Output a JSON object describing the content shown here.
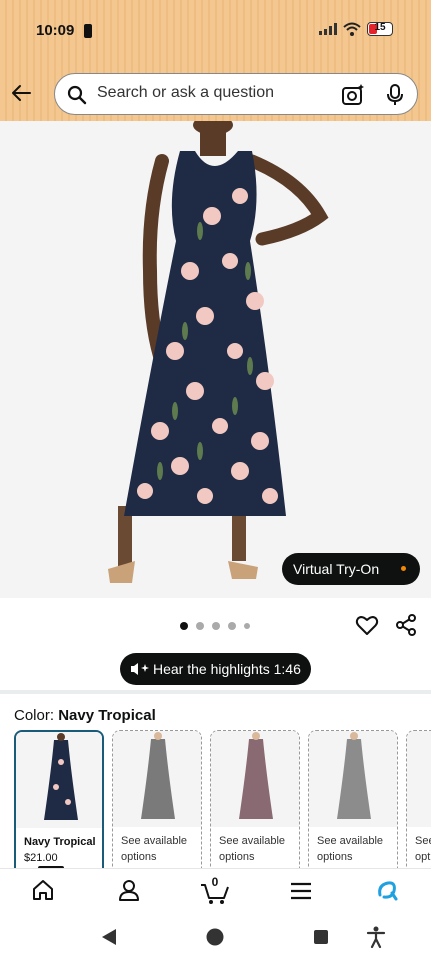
{
  "status_bar": {
    "time": "10:09",
    "battery_level": "15"
  },
  "search": {
    "placeholder": "Search or ask a question"
  },
  "product": {
    "virtual_try_on_label": "Virtual Try-On",
    "image_count": 5,
    "active_image_index": 1
  },
  "highlights": {
    "label": "Hear the highlights 1:46"
  },
  "color": {
    "label": "Color: ",
    "selected_name": "Navy Tropical",
    "swatches": [
      {
        "line1": "Navy Tropical",
        "line2": "$21.00",
        "dress_color": "#1f2a44",
        "selected": true
      },
      {
        "line1": "See available",
        "line2": "options",
        "dress_color": "#7a7a7a",
        "selected": false
      },
      {
        "line1": "See available",
        "line2": "options",
        "dress_color": "#8a6a72",
        "selected": false
      },
      {
        "line1": "See available",
        "line2": "options",
        "dress_color": "#8c8c8c",
        "selected": false
      },
      {
        "line1": "See",
        "line2": "opt",
        "dress_color": "#888888",
        "selected": false
      }
    ]
  },
  "bottom_nav": {
    "items": [
      "home-icon",
      "account-icon",
      "cart-icon",
      "menu-icon",
      "rufus-icon"
    ],
    "cart_count": "0"
  },
  "system_nav": [
    "back-triangle-icon",
    "home-circle-icon",
    "recents-square-icon",
    "accessibility-icon"
  ],
  "colors": {
    "header_bg": "#f3c78f",
    "accent_blue": "#1b5b7a",
    "deal_orange": "#f08804"
  }
}
